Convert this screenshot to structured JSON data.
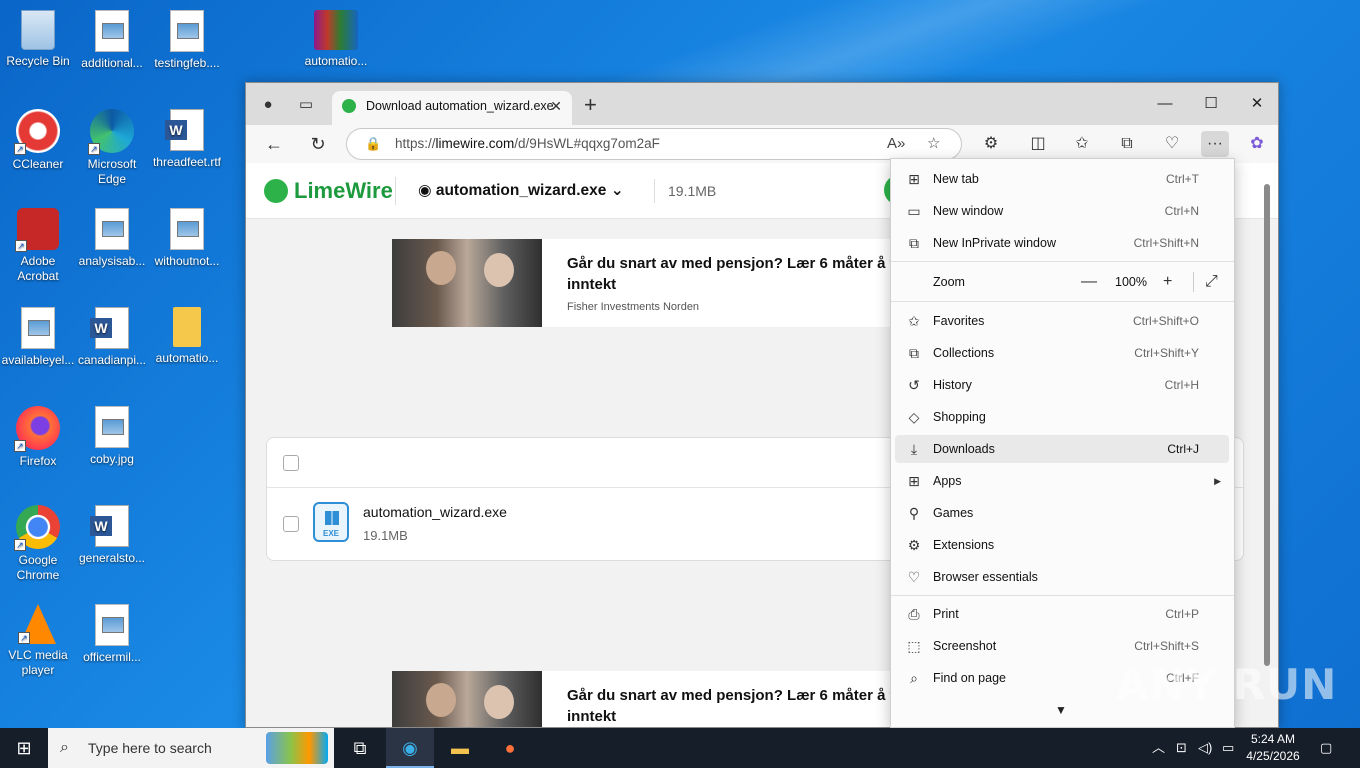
{
  "desktop": {
    "icons": [
      {
        "label": "Recycle Bin",
        "icon": "recycle-bin-icon"
      },
      {
        "label": "additional...",
        "icon": "image-file-icon"
      },
      {
        "label": "testingfeb....",
        "icon": "image-file-icon"
      },
      {
        "label": "automatio...",
        "icon": "winrar-archive-icon"
      },
      {
        "label": "CCleaner",
        "icon": "ccleaner-icon"
      },
      {
        "label": "Microsoft Edge",
        "icon": "edge-icon"
      },
      {
        "label": "threadfeet.rtf",
        "icon": "word-document-icon"
      },
      {
        "label": "Adobe Acrobat",
        "icon": "acrobat-icon"
      },
      {
        "label": "analysisab...",
        "icon": "image-file-icon"
      },
      {
        "label": "withoutnot...",
        "icon": "image-file-icon"
      },
      {
        "label": "availableyel...",
        "icon": "image-file-icon"
      },
      {
        "label": "canadianpi...",
        "icon": "word-document-icon"
      },
      {
        "label": "automatio...",
        "icon": "folder-icon"
      },
      {
        "label": "Firefox",
        "icon": "firefox-icon"
      },
      {
        "label": "coby.jpg",
        "icon": "image-file-icon"
      },
      {
        "label": "Google Chrome",
        "icon": "chrome-icon"
      },
      {
        "label": "generalsto...",
        "icon": "word-document-icon"
      },
      {
        "label": "VLC media player",
        "icon": "vlc-icon"
      },
      {
        "label": "officermil...",
        "icon": "image-file-icon"
      }
    ]
  },
  "browser": {
    "tab_title": "Download automation_wizard.exe",
    "url_prefix": "https://",
    "url_domain": "limewire.com",
    "url_path": "/d/9HsWL#qqxg7om2aF",
    "window_controls": {
      "minimize": "—",
      "maximize": "☐",
      "close": "✕"
    }
  },
  "page": {
    "logo": "LimeWire",
    "file_name": "automation_wizard.exe",
    "file_size": "19.1MB",
    "ad": {
      "headline": "Går du snart av med pensjon? Lær 6 måter å få inntekt",
      "sponsor": "Fisher Investments Norden"
    },
    "file_row": {
      "name": "automation_wizard.exe",
      "size": "19.1MB",
      "badge": "EXE"
    }
  },
  "menu": {
    "items": [
      {
        "label": "New tab",
        "shortcut": "Ctrl+T",
        "icon": "new-tab-icon"
      },
      {
        "label": "New window",
        "shortcut": "Ctrl+N",
        "icon": "new-window-icon"
      },
      {
        "label": "New InPrivate window",
        "shortcut": "Ctrl+Shift+N",
        "icon": "inprivate-icon"
      },
      {
        "label": "Zoom",
        "shortcut": "",
        "icon": ""
      },
      {
        "label": "Favorites",
        "shortcut": "Ctrl+Shift+O",
        "icon": "favorites-icon"
      },
      {
        "label": "Collections",
        "shortcut": "Ctrl+Shift+Y",
        "icon": "collections-icon"
      },
      {
        "label": "History",
        "shortcut": "Ctrl+H",
        "icon": "history-icon"
      },
      {
        "label": "Shopping",
        "shortcut": "",
        "icon": "shopping-tag-icon"
      },
      {
        "label": "Downloads",
        "shortcut": "Ctrl+J",
        "icon": "download-icon"
      },
      {
        "label": "Apps",
        "shortcut": "",
        "icon": "apps-icon"
      },
      {
        "label": "Games",
        "shortcut": "",
        "icon": "games-icon"
      },
      {
        "label": "Extensions",
        "shortcut": "",
        "icon": "extensions-icon"
      },
      {
        "label": "Browser essentials",
        "shortcut": "",
        "icon": "browser-essentials-icon"
      },
      {
        "label": "Print",
        "shortcut": "Ctrl+P",
        "icon": "print-icon"
      },
      {
        "label": "Screenshot",
        "shortcut": "Ctrl+Shift+S",
        "icon": "screenshot-icon"
      },
      {
        "label": "Find on page",
        "shortcut": "Ctrl+F",
        "icon": "find-icon"
      }
    ],
    "zoom_value": "100%",
    "zoom_minus": "—",
    "zoom_plus": "+",
    "highlighted": "Downloads"
  },
  "watermark": "ANY RUN",
  "taskbar": {
    "search_placeholder": "Type here to search",
    "time": "5:24 AM",
    "date": "4/25/2026"
  }
}
